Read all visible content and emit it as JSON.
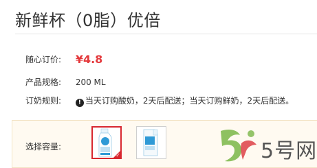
{
  "product": {
    "title": "新鲜杯（0脂）优倍"
  },
  "details": {
    "price_label": "随心订价:",
    "price_value": "¥4.8",
    "spec_label": "产品规格:",
    "spec_value": "200 ML",
    "rule_label": "订奶规则:",
    "rule_value": "当天订购酸奶，2天后配送；当天订购鲜奶，2天后配送。"
  },
  "capacity": {
    "label": "选择容量:",
    "options": [
      {
        "selected": true
      },
      {
        "selected": false
      }
    ]
  },
  "watermark": {
    "text": "5号网",
    "colors": {
      "green": "#7ab648",
      "red": "#d8272f"
    }
  },
  "colors": {
    "accent": "#e4393c",
    "selected_border": "#d8272f",
    "capacity_bg": "#fffaf1"
  }
}
